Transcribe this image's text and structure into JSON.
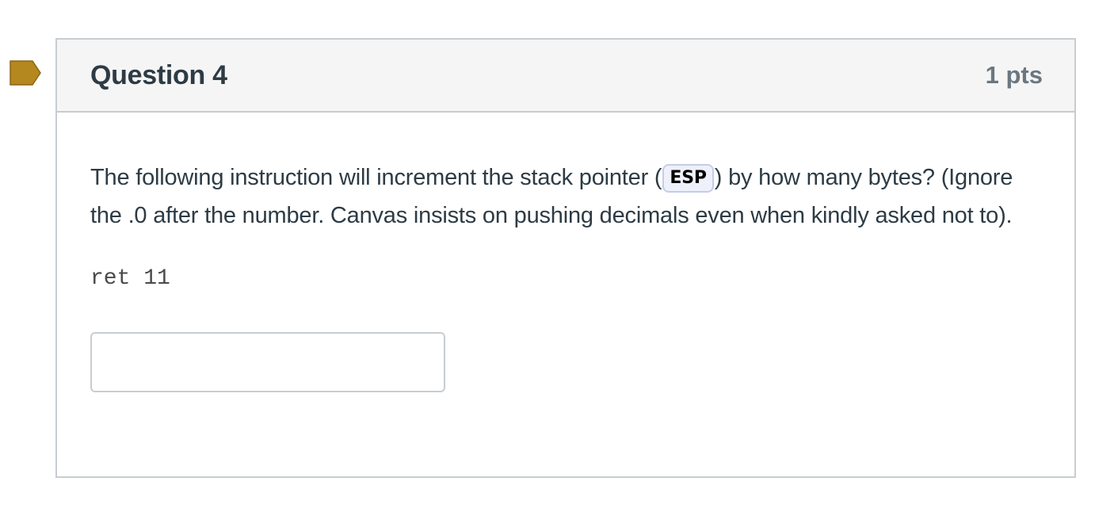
{
  "question": {
    "title": "Question 4",
    "points": "1 pts",
    "text_before": "The following instruction will increment the stack pointer (",
    "register": "ESP",
    "text_after": ") by how many bytes? (Ignore the .0 after the number. Canvas insists on pushing decimals even when kindly asked not to).",
    "code": "ret 11",
    "answer": {
      "value": "",
      "placeholder": ""
    }
  },
  "colors": {
    "flag": "#b5871f",
    "header_bg": "#f5f5f5",
    "border": "#c7cdd1",
    "text": "#2d3b45",
    "points_text": "#6b7780"
  },
  "icons": {
    "flag": "bookmark-flag-icon"
  }
}
